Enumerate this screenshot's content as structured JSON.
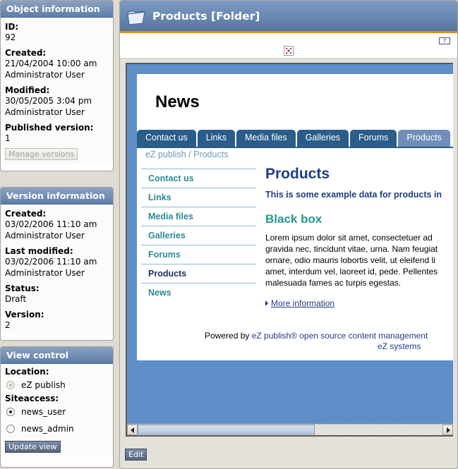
{
  "object_info": {
    "title": "Object information",
    "id_label": "ID:",
    "id_value": "92",
    "created_label": "Created:",
    "created_date": "21/04/2004 10:00 am",
    "created_user": "Administrator User",
    "modified_label": "Modified:",
    "modified_date": "30/05/2005 3:04 pm",
    "modified_user": "Administrator User",
    "published_label": "Published version:",
    "published_value": "1",
    "manage_versions_label": "Manage versions"
  },
  "version_info": {
    "title": "Version information",
    "created_label": "Created:",
    "created_date": "03/02/2006 11:10 am",
    "created_user": "Administrator User",
    "last_modified_label": "Last modified:",
    "last_modified_date": "03/02/2006 11:10 am",
    "last_modified_user": "Administrator User",
    "status_label": "Status:",
    "status_value": "Draft",
    "version_label": "Version:",
    "version_value": "2"
  },
  "view_control": {
    "title": "View control",
    "location_label": "Location:",
    "location_option": "eZ publish",
    "siteaccess_label": "Siteaccess:",
    "siteaccess_options": [
      "news_user",
      "news_admin"
    ],
    "selected_siteaccess": "news_user",
    "update_view_label": "Update view"
  },
  "main": {
    "title": "Products [Folder]",
    "tiny_button_label": "?",
    "edit_label": "Edit"
  },
  "preview": {
    "site_title": "News",
    "tabs": [
      "Contact us",
      "Links",
      "Media files",
      "Galleries",
      "Forums",
      "Products"
    ],
    "active_tab": "Products",
    "breadcrumb": [
      "eZ publish",
      "Products"
    ],
    "breadcrumb_separator": " / ",
    "nav": [
      "Contact us",
      "Links",
      "Media files",
      "Galleries",
      "Forums",
      "Products",
      "News"
    ],
    "current_nav": "Products",
    "heading": "Products",
    "intro": "This is some example data for products in",
    "subheading": "Black box",
    "body_lines": [
      "Lorem ipsum dolor sit amet, consectetuer ad",
      "gravida nec, tincidunt vitae, urna. Nam feugiat",
      "ornare, odio mauris lobortis velit, ut eleifend li",
      "amet, interdum vel, laoreet id, pede. Pellentes",
      "malesuada fames ac turpis egestas."
    ],
    "more_link": "More information",
    "footer_prefix": "Powered by ",
    "footer_brand": "eZ publish® open source content management",
    "footer_company": "eZ systems"
  },
  "colors": {
    "panel_header": "#6f8cb3",
    "tab_bg": "#2b5d8a",
    "heading": "#1f3d82",
    "accent_teal": "#24978e",
    "orange_rule": "#e98a1b"
  }
}
